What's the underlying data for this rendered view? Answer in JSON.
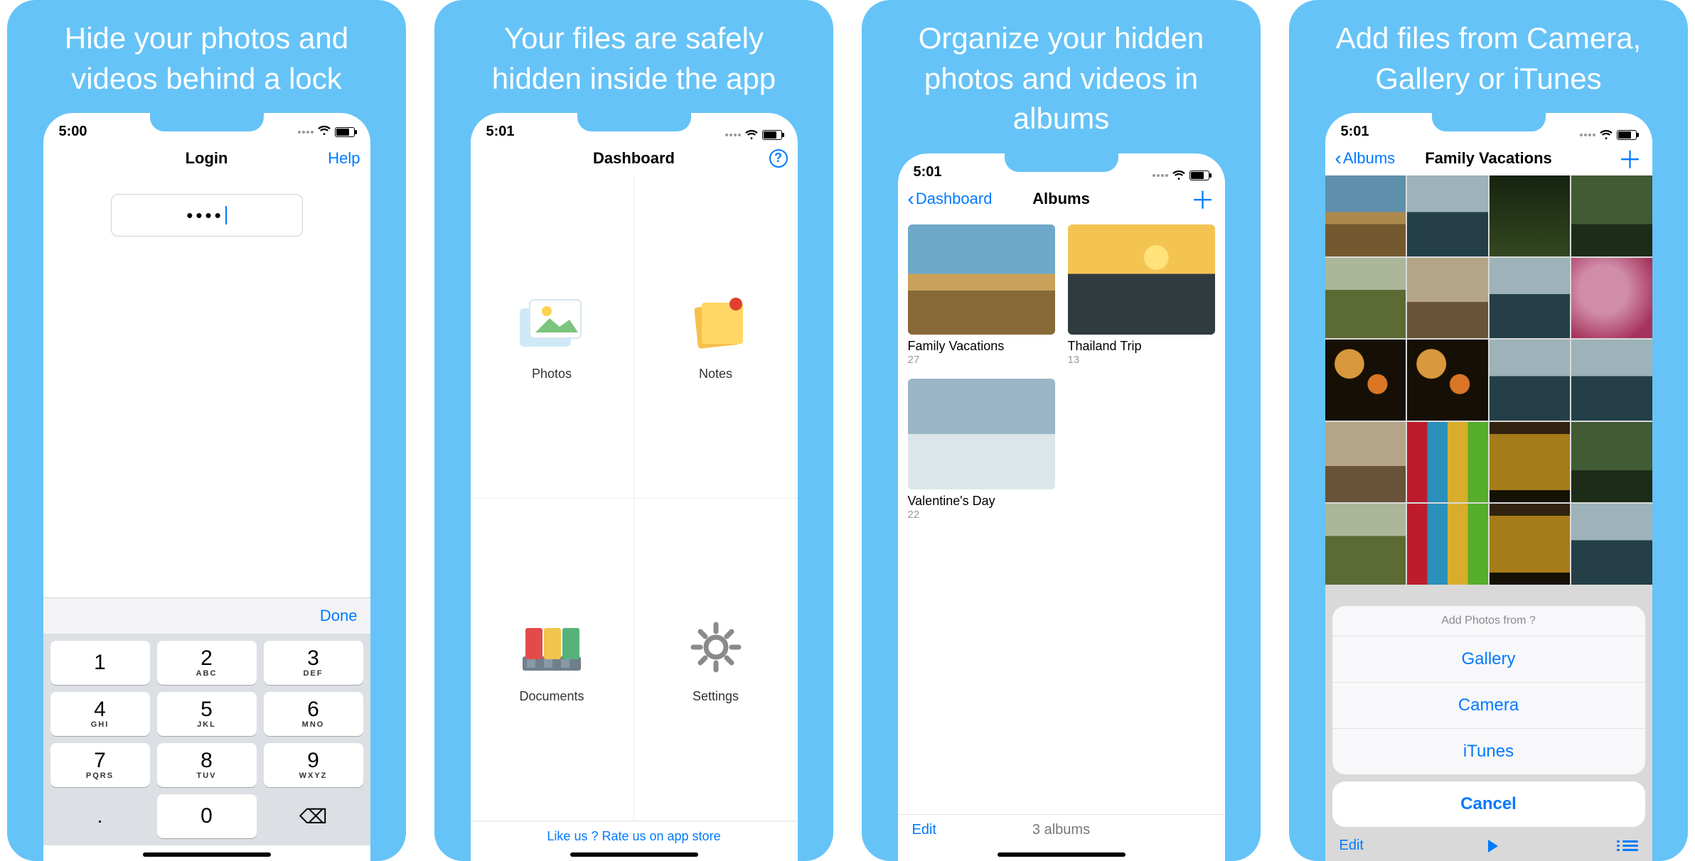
{
  "panels": [
    {
      "caption": "Hide your photos and videos behind a lock"
    },
    {
      "caption": "Your files are safely hidden inside the app"
    },
    {
      "caption": "Organize your hidden photos and videos in albums"
    },
    {
      "caption": "Add files from Camera, Gallery or iTunes"
    }
  ],
  "phone1": {
    "time": "5:00",
    "nav_title": "Login",
    "nav_right": "Help",
    "password_mask": "••••",
    "kbd_done": "Done",
    "keys": [
      {
        "n": "1",
        "s": ""
      },
      {
        "n": "2",
        "s": "ABC"
      },
      {
        "n": "3",
        "s": "DEF"
      },
      {
        "n": "4",
        "s": "GHI"
      },
      {
        "n": "5",
        "s": "JKL"
      },
      {
        "n": "6",
        "s": "MNO"
      },
      {
        "n": "7",
        "s": "PQRS"
      },
      {
        "n": "8",
        "s": "TUV"
      },
      {
        "n": "9",
        "s": "WXYZ"
      }
    ],
    "key_dot": ".",
    "key_zero": "0",
    "key_del": "⌫"
  },
  "phone2": {
    "time": "5:01",
    "nav_title": "Dashboard",
    "items": [
      {
        "label": "Photos"
      },
      {
        "label": "Notes"
      },
      {
        "label": "Documents"
      },
      {
        "label": "Settings"
      }
    ],
    "rate_text": "Like us ? Rate us on app store"
  },
  "phone3": {
    "time": "5:01",
    "nav_back": "Dashboard",
    "nav_title": "Albums",
    "albums": [
      {
        "name": "Family Vacations",
        "count": "27",
        "scene": "desert"
      },
      {
        "name": "Thailand Trip",
        "count": "13",
        "scene": "sunset"
      },
      {
        "name": "Valentine's Day",
        "count": "22",
        "scene": "snow"
      }
    ],
    "edit": "Edit",
    "footer_count": "3 albums"
  },
  "phone4": {
    "time": "5:01",
    "nav_back": "Albums",
    "nav_title": "Family Vacations",
    "thumbs": [
      "desert",
      "sea",
      "tree",
      "green",
      "field",
      "rock",
      "sea",
      "pink",
      "lant",
      "lant",
      "sea",
      "sea",
      "rock",
      "color",
      "arch",
      "green",
      "field",
      "color",
      "arch",
      "sea"
    ],
    "sheet_title": "Add Photos from ?",
    "sheet_options": [
      "Gallery",
      "Camera",
      "iTunes"
    ],
    "sheet_cancel": "Cancel",
    "edit": "Edit"
  }
}
